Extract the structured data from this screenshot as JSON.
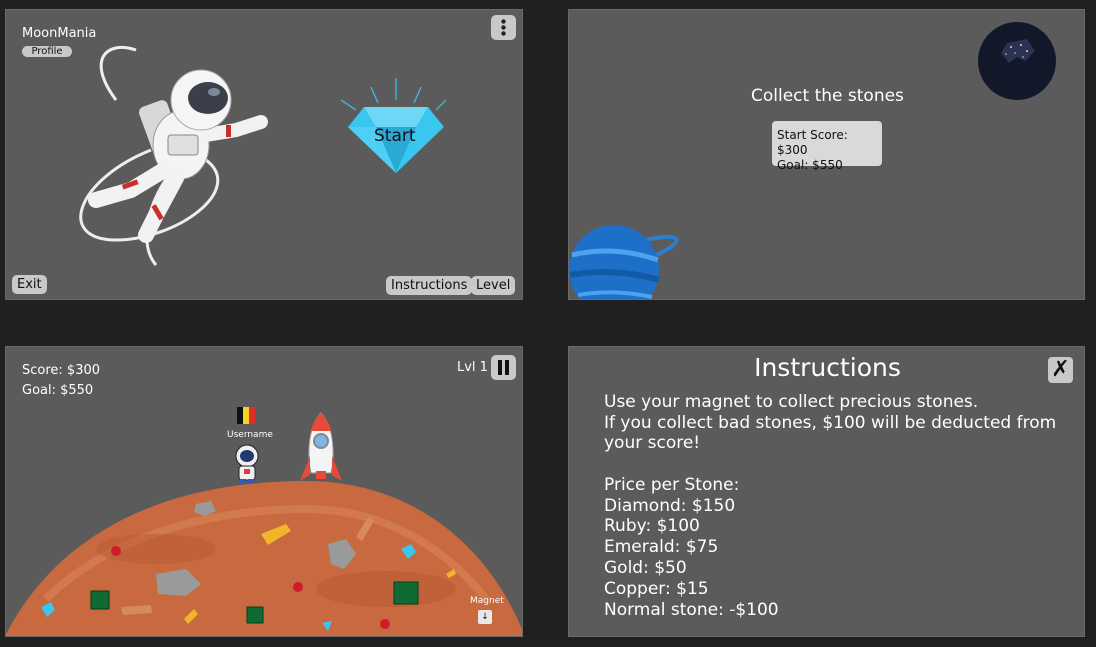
{
  "menu": {
    "app_title": "MoonMania",
    "profile_label": "Profile",
    "start_label": "Start",
    "exit_label": "Exit",
    "instructions_label": "Instructions",
    "level_label": "Level",
    "menu_icon": "vertical-dots-icon"
  },
  "intro": {
    "title": "Collect the stones",
    "start_score": "Start Score: $300",
    "goal": "Goal: $550"
  },
  "game": {
    "score": "Score: $300",
    "goal": "Goal: $550",
    "level": "Lvl 1",
    "username": "Username",
    "magnet_label": "Magnet",
    "magnet_icon": "down-arrow-icon",
    "pause_icon": "pause-icon"
  },
  "instructions": {
    "title": "Instructions",
    "close_icon": "close-icon",
    "lines": [
      "Use your magnet to collect precious stones.",
      "If you collect bad stones, $100 will be deducted from",
      "your score!",
      "",
      "Price per Stone:",
      "Diamond: $150",
      "Ruby: $100",
      "Emerald: $75",
      "Gold: $50",
      "Copper: $15",
      "Normal stone: -$100"
    ]
  },
  "colors": {
    "background": "#202020",
    "panel": "#5b5b5b",
    "button": "#c9c9c9",
    "planet": "#c8693f",
    "diamond": "#39c6ef"
  }
}
